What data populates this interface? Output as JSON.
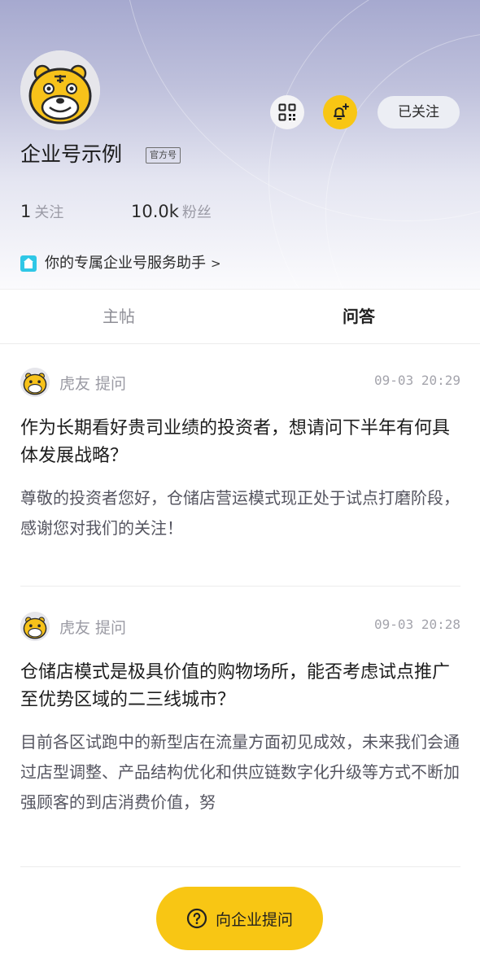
{
  "profile": {
    "name": "企业号示例",
    "badge": "官方号",
    "follow_label": "已关注",
    "icons": [
      "qr-code-icon",
      "bell-plus-icon"
    ]
  },
  "stats": {
    "following_count": "1",
    "following_label": "关注",
    "fans_count": "10.0k",
    "fans_label": "粉丝"
  },
  "assistant": {
    "text": "你的专属企业号服务助手",
    "arrow": ">",
    "icon": "enterprise-assistant-icon"
  },
  "tabs": [
    {
      "label": "主帖",
      "active": false
    },
    {
      "label": "问答",
      "active": true
    }
  ],
  "qa_items": [
    {
      "asker": "虎友 提问",
      "time": "09-03 20:29",
      "question": "作为长期看好贵司业绩的投资者，想请问下半年有何具体发展战略？",
      "answer": "尊敬的投资者您好，仓储店营运模式现正处于试点打磨阶段，感谢您对我们的关注！"
    },
    {
      "asker": "虎友 提问",
      "time": "09-03 20:28",
      "question": "仓储店模式是极具价值的购物场所，能否考虑试点推广至优势区域的二三线城市？",
      "answer": "目前各区试跑中的新型店在流量方面初见成效，未来我们会通过店型调整、产品结构优化和供应链数字化升级等方式不断加强顾客的到店消费价值，努"
    }
  ],
  "ask_button": {
    "label": "向企业提问",
    "icon": "question-circle-icon"
  },
  "colors": {
    "accent": "#f8c614",
    "header_top": "#a6a9cf",
    "text_muted": "#9a9aa3"
  }
}
